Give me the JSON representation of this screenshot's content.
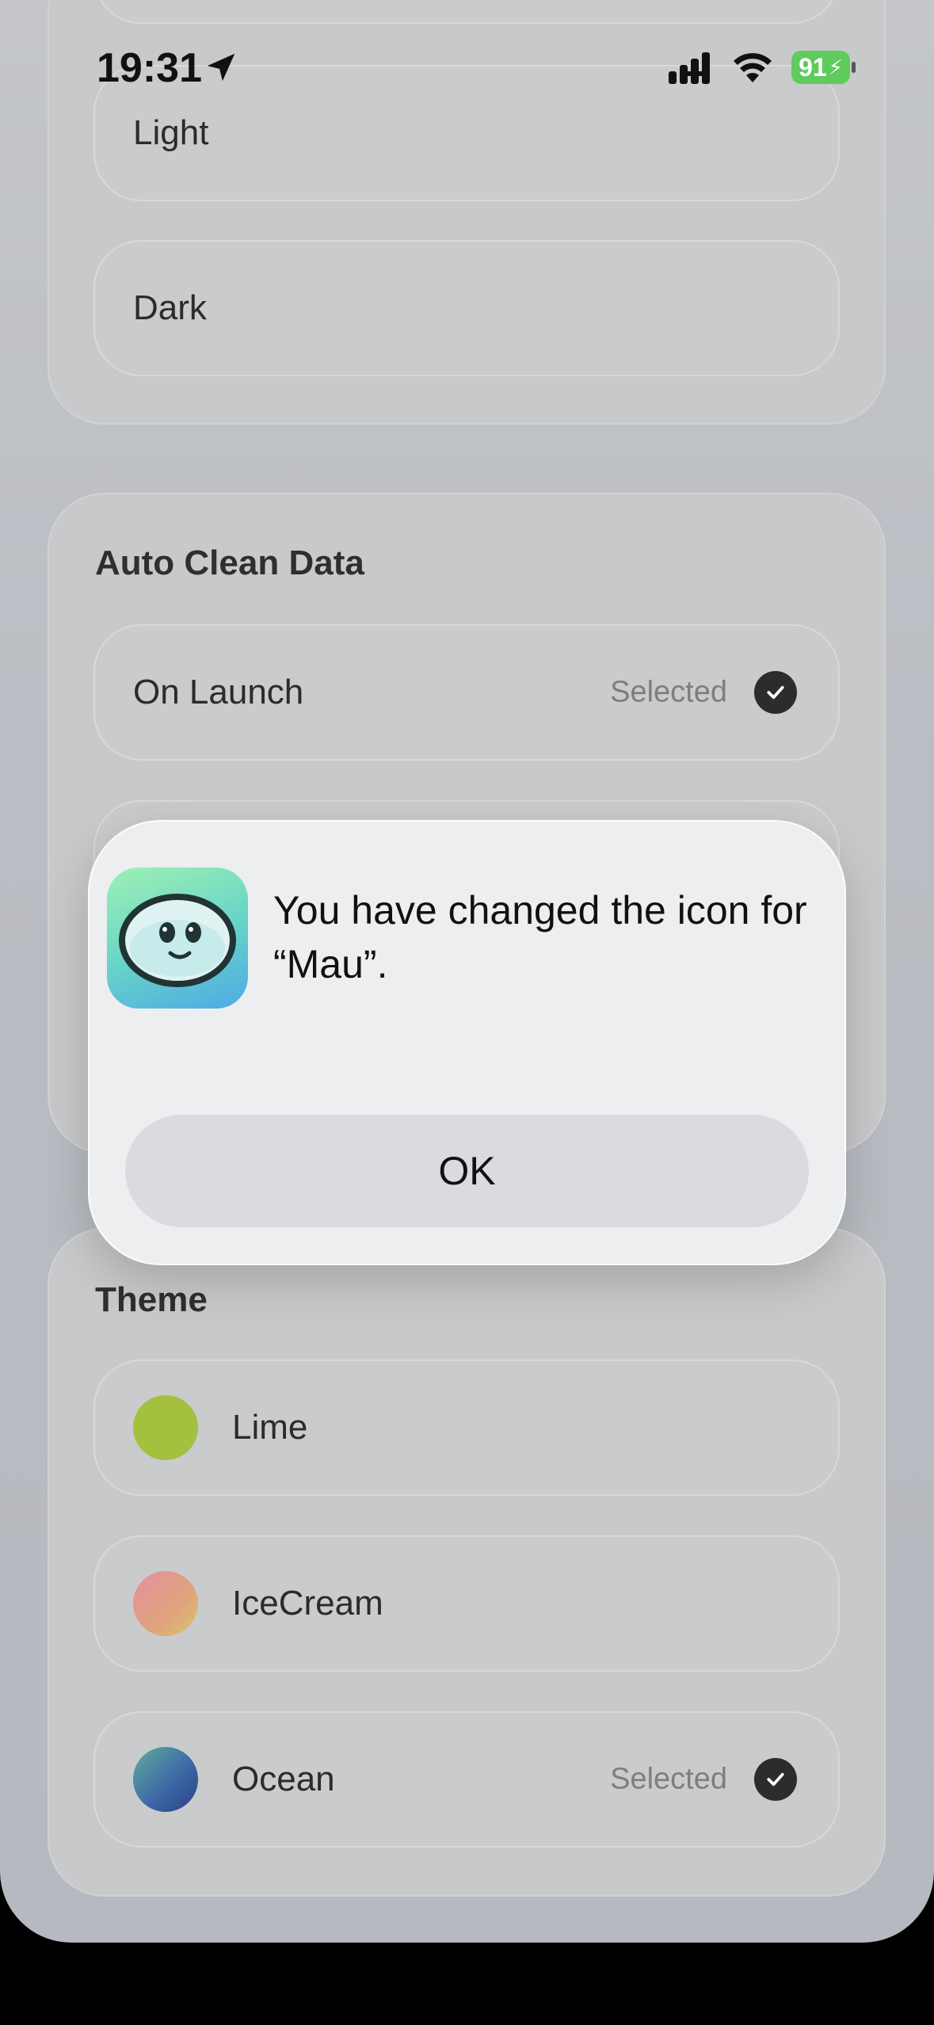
{
  "status_bar": {
    "time": "19:31",
    "battery": "91"
  },
  "appearance": {
    "items": [
      {
        "label": "Light"
      },
      {
        "label": "Dark"
      }
    ]
  },
  "auto_clean": {
    "title": "Auto Clean Data",
    "items": [
      {
        "label": "On Launch",
        "selected_label": "Selected"
      }
    ]
  },
  "theme": {
    "title": "Theme",
    "items": [
      {
        "label": "Lime",
        "color": "#a3c13f"
      },
      {
        "label": "IceCream",
        "color": "#e59a9a"
      },
      {
        "label": "Ocean",
        "color": "#3f6aa8",
        "selected_label": "Selected"
      }
    ]
  },
  "alert": {
    "message": "You have changed the icon for “Mau”.",
    "ok_label": "OK"
  }
}
